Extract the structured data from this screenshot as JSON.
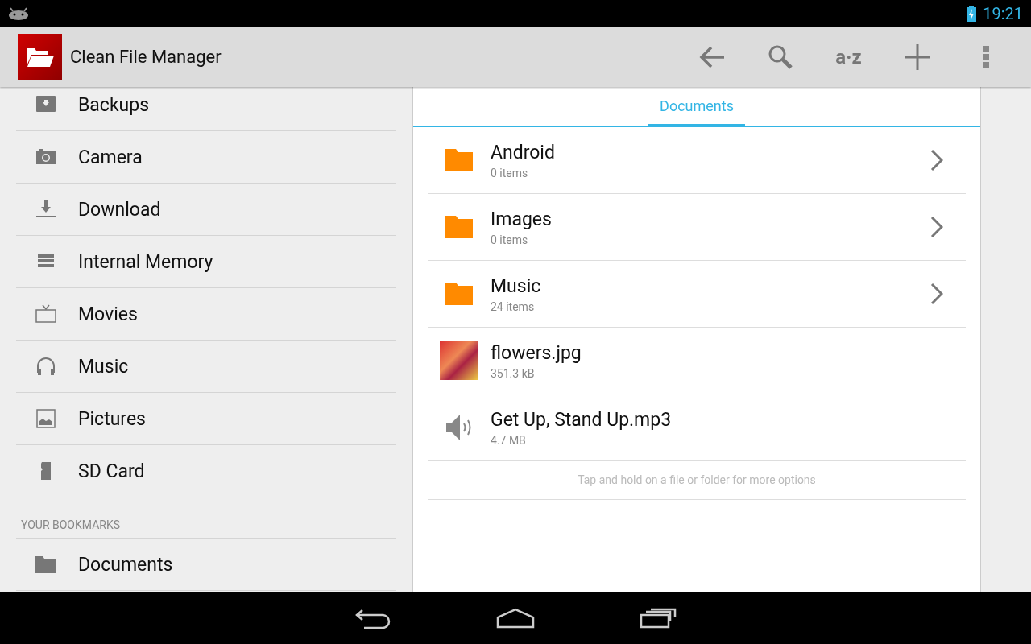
{
  "status_bar": {
    "time": "19:21"
  },
  "action_bar": {
    "title": "Clean File Manager",
    "sort_label": "a·z"
  },
  "sidebar": {
    "items": [
      {
        "label": "Backups"
      },
      {
        "label": "Camera"
      },
      {
        "label": "Download"
      },
      {
        "label": "Internal Memory"
      },
      {
        "label": "Movies"
      },
      {
        "label": "Music"
      },
      {
        "label": "Pictures"
      },
      {
        "label": "SD Card"
      }
    ],
    "bookmarks_heading": "YOUR BOOKMARKS",
    "bookmarks": [
      {
        "label": "Documents"
      }
    ]
  },
  "tabs": [
    {
      "label": "Documents",
      "selected": true
    }
  ],
  "files": [
    {
      "kind": "folder",
      "name": "Android",
      "detail": "0 items"
    },
    {
      "kind": "folder",
      "name": "Images",
      "detail": "0 items"
    },
    {
      "kind": "folder",
      "name": "Music",
      "detail": "24 items"
    },
    {
      "kind": "image",
      "name": "flowers.jpg",
      "detail": "351.3 kB"
    },
    {
      "kind": "audio",
      "name": "Get Up, Stand Up.mp3",
      "detail": "4.7 MB"
    }
  ],
  "hint": "Tap and hold on a file or folder for more options"
}
